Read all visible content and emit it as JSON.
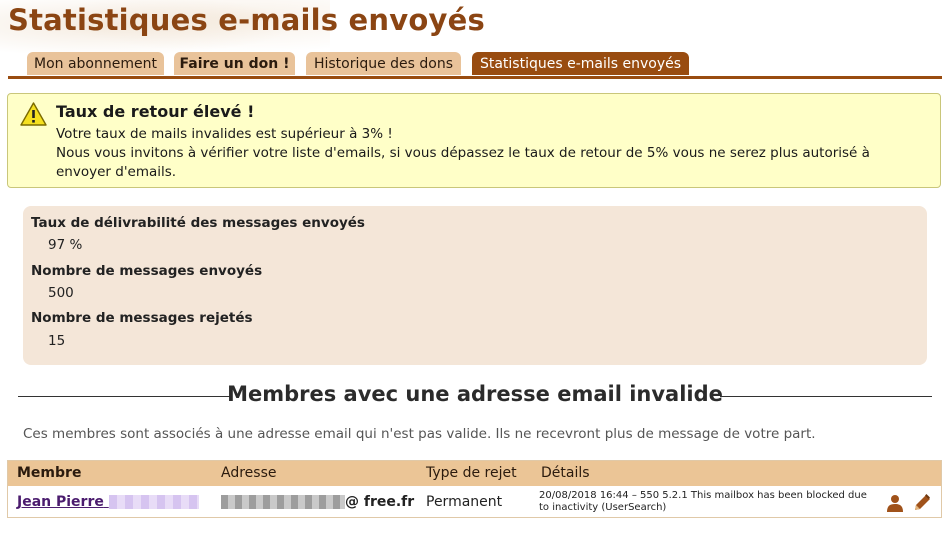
{
  "page": {
    "title": "Statistiques e-mails envoyés"
  },
  "tabs": [
    {
      "label": "Mon abonnement",
      "bold": false,
      "active": false
    },
    {
      "label": "Faire un don !",
      "bold": true,
      "active": false
    },
    {
      "label": "Historique des dons",
      "bold": false,
      "active": false
    },
    {
      "label": "Statistiques e-mails envoyés",
      "bold": false,
      "active": true
    }
  ],
  "alert": {
    "icon": "warning-icon",
    "title": "Taux de retour élevé !",
    "line1": "Votre taux de mails invalides est supérieur à 3% !",
    "line2": "Nous vous invitons à vérifier votre liste d'emails, si vous dépassez le taux de retour de 5% vous ne serez plus autorisé à",
    "line3": "envoyer d'emails."
  },
  "stats": {
    "deliverability_label": "Taux de délivrabilité des messages envoyés",
    "deliverability_value": "97 %",
    "sent_label": "Nombre de messages envoyés",
    "sent_value": "500",
    "rejected_label": "Nombre de messages rejetés",
    "rejected_value": "15"
  },
  "section": {
    "title": "Membres avec une adresse email invalide",
    "description": "Ces membres sont associés à une adresse email qui n'est pas valide. Ils ne recevront plus de message de votre part."
  },
  "table": {
    "headers": {
      "member": "Membre",
      "address": "Adresse",
      "type": "Type de rejet",
      "details": "Détails"
    },
    "rows": [
      {
        "member": "Jean Pierre",
        "address_domain": "@ free.fr",
        "type": "Permanent",
        "details_line1": "20/08/2018 16:44 – 550 5.2.1 This mailbox has been blocked due",
        "details_line2": "to inactivity (UserSearch)",
        "actions": [
          "user-icon",
          "pencil-icon"
        ]
      }
    ]
  },
  "colors": {
    "brand": "#8b4513",
    "tab_active": "#994c10",
    "tab_inactive": "#e9c39a",
    "alert_bg": "#ffffc8",
    "stats_bg": "#f4e6d8",
    "table_header": "#ebc596"
  }
}
